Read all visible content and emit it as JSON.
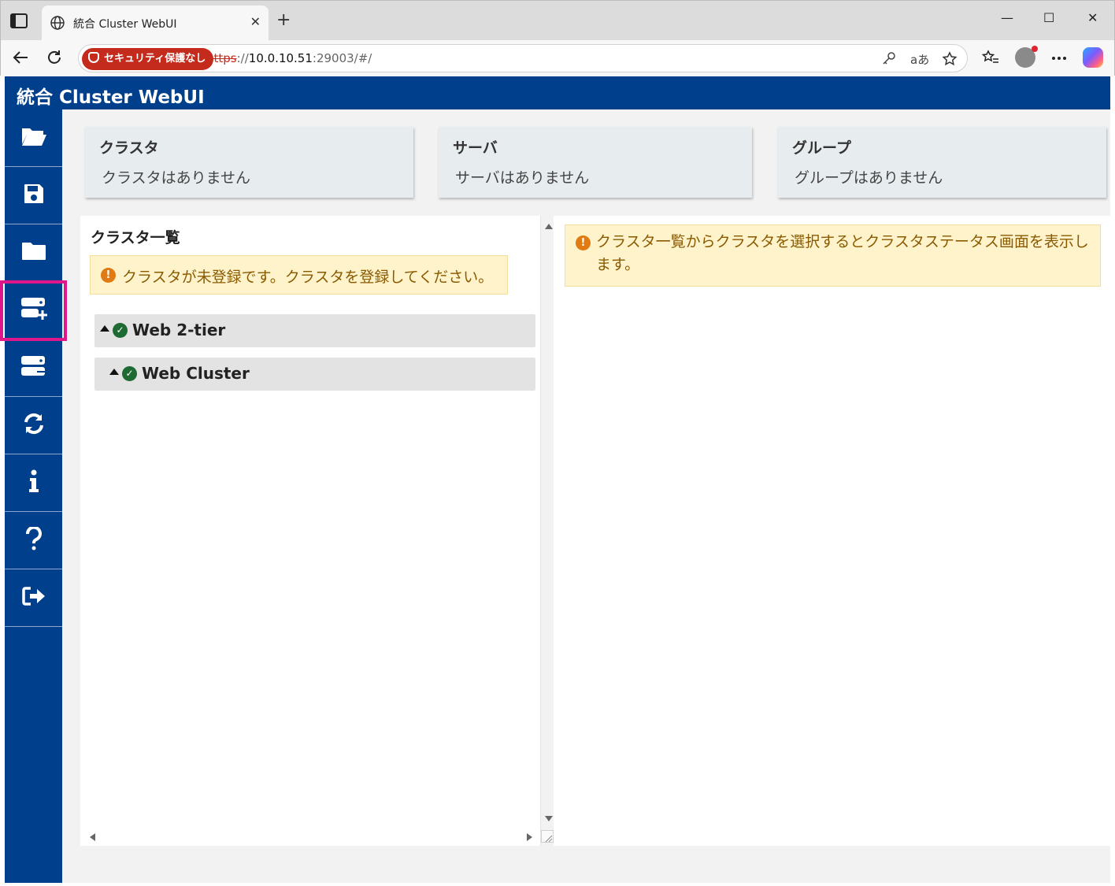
{
  "browser": {
    "tab_title": "統合 Cluster WebUI",
    "new_tab": "+",
    "security_badge": "セキュリティ保護なし",
    "url_scheme": "https",
    "url_sep": "://",
    "url_host": "10.0.10.51",
    "url_port_path": ":29003/#/",
    "read_aloud": "aあ",
    "window_minimize": "—",
    "window_maximize": "☐",
    "window_close": "✕"
  },
  "app": {
    "title": "統合 Cluster WebUI"
  },
  "sidebar": {
    "items": [
      {
        "name": "open-config",
        "icon": "folder-open-icon"
      },
      {
        "name": "save-config",
        "icon": "save-icon"
      },
      {
        "name": "folder",
        "icon": "folder-icon"
      },
      {
        "name": "add-cluster",
        "icon": "server-add-icon",
        "highlighted": true
      },
      {
        "name": "server-list",
        "icon": "server-list-icon"
      },
      {
        "name": "reload",
        "icon": "reload-icon"
      },
      {
        "name": "info",
        "icon": "info-icon"
      },
      {
        "name": "help",
        "icon": "help-icon"
      },
      {
        "name": "logout",
        "icon": "logout-icon"
      }
    ]
  },
  "summary": {
    "cluster": {
      "heading": "クラスタ",
      "value": "クラスタはありません"
    },
    "server": {
      "heading": "サーバ",
      "value": "サーバはありません"
    },
    "group": {
      "heading": "グループ",
      "value": "グループはありません"
    }
  },
  "cluster_list": {
    "title": "クラスタ一覧",
    "alert": "クラスタが未登録です。クラスタを登録してください。",
    "rows": [
      {
        "name": "Web 2-tier",
        "status": "ok"
      },
      {
        "name": "Web Cluster",
        "status": "ok"
      }
    ]
  },
  "detail": {
    "alert": "クラスタ一覧からクラスタを選択するとクラスタステータス画面を表示します。"
  },
  "colors": {
    "brand": "#003f8c",
    "highlight": "#e0178a",
    "alert_bg": "#fff3cc",
    "ok_green": "#1d6a33"
  }
}
